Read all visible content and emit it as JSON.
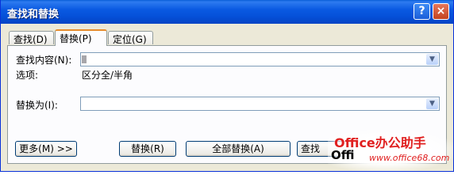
{
  "window": {
    "title": "查找和替换",
    "help_label": "?",
    "close_label": "×"
  },
  "tabs": [
    {
      "label": "查找(D)"
    },
    {
      "label": "替换(P)"
    },
    {
      "label": "定位(G)"
    }
  ],
  "find": {
    "label": "查找内容(N):",
    "value": ""
  },
  "options": {
    "label": "选项:",
    "value": "区分全/半角"
  },
  "replace": {
    "label": "替换为(I):",
    "value": ""
  },
  "buttons": {
    "more": "更多(M) >>",
    "replace": "替换(R)",
    "replace_all": "全部替换(A)",
    "find_next": "查找"
  },
  "watermark": {
    "line1": "Office办公助手",
    "line2": "Offi",
    "url": "www.office68.com"
  },
  "colors": {
    "title_bar": "#0a5ae2",
    "accent_tab": "#e68b2c",
    "face": "#ece9d8"
  }
}
